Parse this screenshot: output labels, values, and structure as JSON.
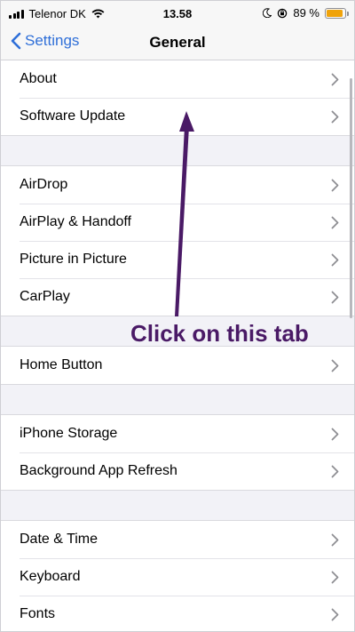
{
  "status_bar": {
    "carrier": "Telenor DK",
    "time": "13.58",
    "battery_percent_label": "89 %",
    "battery_level": 0.89,
    "icons": [
      "signal-icon",
      "wifi-icon",
      "moon-icon",
      "rotation-lock-icon",
      "battery-icon"
    ]
  },
  "nav": {
    "back_label": "Settings",
    "title": "General"
  },
  "groups": [
    {
      "items": [
        {
          "label": "About"
        },
        {
          "label": "Software Update"
        }
      ]
    },
    {
      "items": [
        {
          "label": "AirDrop"
        },
        {
          "label": "AirPlay & Handoff"
        },
        {
          "label": "Picture in Picture"
        },
        {
          "label": "CarPlay"
        }
      ]
    },
    {
      "items": [
        {
          "label": "Home Button"
        }
      ]
    },
    {
      "items": [
        {
          "label": "iPhone Storage"
        },
        {
          "label": "Background App Refresh"
        }
      ]
    },
    {
      "items": [
        {
          "label": "Date & Time"
        },
        {
          "label": "Keyboard"
        },
        {
          "label": "Fonts"
        }
      ]
    }
  ],
  "annotation": {
    "text": "Click on this tab",
    "color": "#4a1a66"
  },
  "colors": {
    "accent": "#2f6fd8",
    "background": "#f2f2f7",
    "battery": "#f0a30a"
  }
}
